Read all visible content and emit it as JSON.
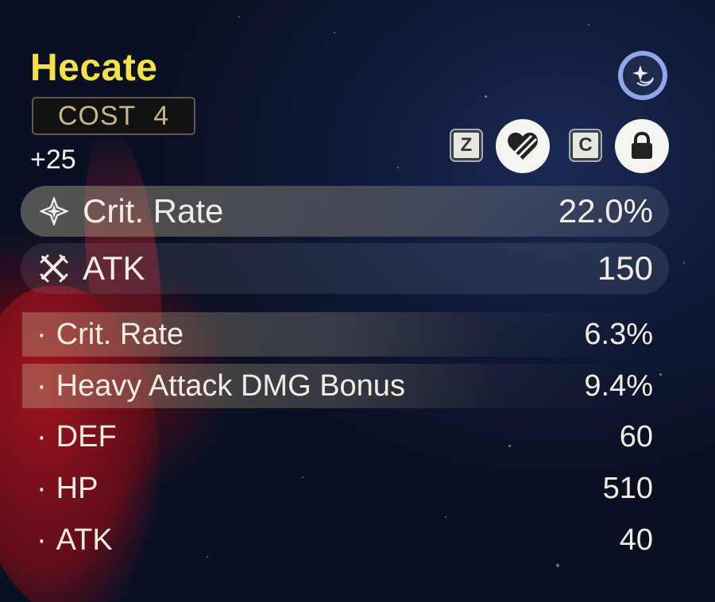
{
  "echo": {
    "name": "Hecate",
    "cost_label": "COST",
    "cost_value": "4",
    "level": "+25"
  },
  "hotkeys": {
    "discard_key": "Z",
    "lock_key": "C"
  },
  "main_stats": [
    {
      "label": "Crit. Rate",
      "value": "22.0%",
      "icon": "crit-rate-icon"
    },
    {
      "label": "ATK",
      "value": "150",
      "icon": "atk-icon"
    }
  ],
  "sub_stats": [
    {
      "bullet": "·",
      "label": "Crit. Rate",
      "value": "6.3%"
    },
    {
      "bullet": "·",
      "label": "Heavy Attack DMG Bonus",
      "value": "9.4%"
    },
    {
      "bullet": "·",
      "label": "DEF",
      "value": "60"
    },
    {
      "bullet": "·",
      "label": "HP",
      "value": "510"
    },
    {
      "bullet": "·",
      "label": "ATK",
      "value": "40"
    }
  ],
  "colors": {
    "title": "#f3e14a",
    "cost_text": "#c7b78a",
    "sparkle_ring": "#8fa7ea"
  }
}
